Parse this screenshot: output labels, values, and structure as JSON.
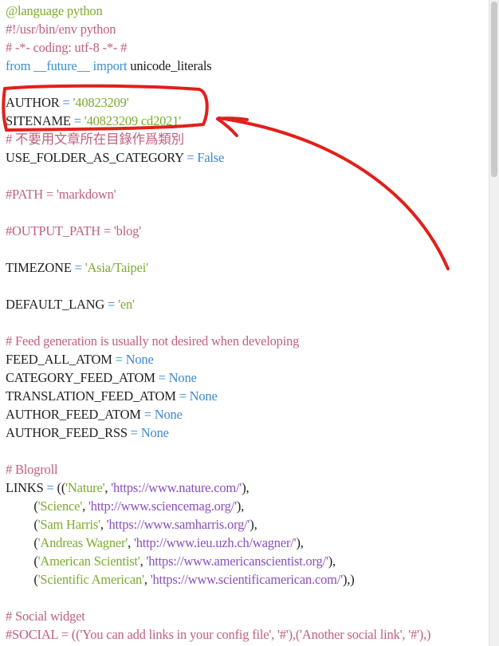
{
  "lines": [
    [
      [
        "decorator",
        "@language python"
      ]
    ],
    [
      [
        "comment",
        "#!/usr/bin/env python"
      ]
    ],
    [
      [
        "comment",
        "# -*- coding: utf-8 -*- #"
      ]
    ],
    [
      [
        "keyword",
        "from"
      ],
      [
        "plain",
        " "
      ],
      [
        "keyword",
        "__future__"
      ],
      [
        "plain",
        " "
      ],
      [
        "keyword",
        "import"
      ],
      [
        "plain",
        " unicode_literals"
      ]
    ],
    [],
    [
      [
        "plain",
        "AUTHOR "
      ],
      [
        "op",
        "="
      ],
      [
        "plain",
        " "
      ],
      [
        "string",
        "'40823209'"
      ]
    ],
    [
      [
        "plain",
        "SITENAME "
      ],
      [
        "op",
        "="
      ],
      [
        "plain",
        " "
      ],
      [
        "string",
        "'40823209 cd2021'"
      ]
    ],
    [
      [
        "comment",
        "# 不要用文章所在目錄作爲類別"
      ]
    ],
    [
      [
        "plain",
        "USE_FOLDER_AS_CATEGORY "
      ],
      [
        "op",
        "="
      ],
      [
        "plain",
        " "
      ],
      [
        "const",
        "False"
      ]
    ],
    [],
    [
      [
        "comment",
        "#PATH = 'markdown'"
      ]
    ],
    [],
    [
      [
        "comment",
        "#OUTPUT_PATH = 'blog'"
      ]
    ],
    [],
    [
      [
        "plain",
        "TIMEZONE "
      ],
      [
        "op",
        "="
      ],
      [
        "plain",
        " "
      ],
      [
        "string",
        "'Asia/Taipei'"
      ]
    ],
    [],
    [
      [
        "plain",
        "DEFAULT_LANG "
      ],
      [
        "op",
        "="
      ],
      [
        "plain",
        " "
      ],
      [
        "string",
        "'en'"
      ]
    ],
    [],
    [
      [
        "comment",
        "# Feed generation is usually not desired when developing"
      ]
    ],
    [
      [
        "plain",
        "FEED_ALL_ATOM "
      ],
      [
        "op",
        "="
      ],
      [
        "plain",
        " "
      ],
      [
        "const",
        "None"
      ]
    ],
    [
      [
        "plain",
        "CATEGORY_FEED_ATOM "
      ],
      [
        "op",
        "="
      ],
      [
        "plain",
        " "
      ],
      [
        "const",
        "None"
      ]
    ],
    [
      [
        "plain",
        "TRANSLATION_FEED_ATOM "
      ],
      [
        "op",
        "="
      ],
      [
        "plain",
        " "
      ],
      [
        "const",
        "None"
      ]
    ],
    [
      [
        "plain",
        "AUTHOR_FEED_ATOM "
      ],
      [
        "op",
        "="
      ],
      [
        "plain",
        " "
      ],
      [
        "const",
        "None"
      ]
    ],
    [
      [
        "plain",
        "AUTHOR_FEED_RSS "
      ],
      [
        "op",
        "="
      ],
      [
        "plain",
        " "
      ],
      [
        "const",
        "None"
      ]
    ],
    [],
    [
      [
        "comment",
        "# Blogroll"
      ]
    ],
    [
      [
        "plain",
        "LINKS "
      ],
      [
        "op",
        "="
      ],
      [
        "plain",
        " (("
      ],
      [
        "string",
        "'Nature'"
      ],
      [
        "plain",
        ", "
      ],
      [
        "url",
        "'https://www.nature.com/'"
      ],
      [
        "plain",
        "),"
      ]
    ],
    [
      [
        "plain",
        "         ("
      ],
      [
        "string",
        "'Science'"
      ],
      [
        "plain",
        ", "
      ],
      [
        "url",
        "'http://www.sciencemag.org/'"
      ],
      [
        "plain",
        "),"
      ]
    ],
    [
      [
        "plain",
        "         ("
      ],
      [
        "string",
        "'Sam Harris'"
      ],
      [
        "plain",
        ", "
      ],
      [
        "url",
        "'https://www.samharris.org/'"
      ],
      [
        "plain",
        "),"
      ]
    ],
    [
      [
        "plain",
        "         ("
      ],
      [
        "string",
        "'Andreas Wagner'"
      ],
      [
        "plain",
        ", "
      ],
      [
        "url",
        "'http://www.ieu.uzh.ch/wagner/'"
      ],
      [
        "plain",
        "),"
      ]
    ],
    [
      [
        "plain",
        "         ("
      ],
      [
        "string",
        "'American Scientist'"
      ],
      [
        "plain",
        ", "
      ],
      [
        "url",
        "'https://www.americanscientist.org/'"
      ],
      [
        "plain",
        "),"
      ]
    ],
    [
      [
        "plain",
        "         ("
      ],
      [
        "string",
        "'Scientific American'"
      ],
      [
        "plain",
        ", "
      ],
      [
        "url",
        "'https://www.scientificamerican.com/'"
      ],
      [
        "plain",
        "),)"
      ]
    ],
    [],
    [
      [
        "comment",
        "# Social widget"
      ]
    ],
    [
      [
        "comment",
        "#SOCIAL = (('You can add links in your config file', '#'),('Another social link', '#'),)"
      ]
    ]
  ],
  "annotation_color": "#e0201b"
}
